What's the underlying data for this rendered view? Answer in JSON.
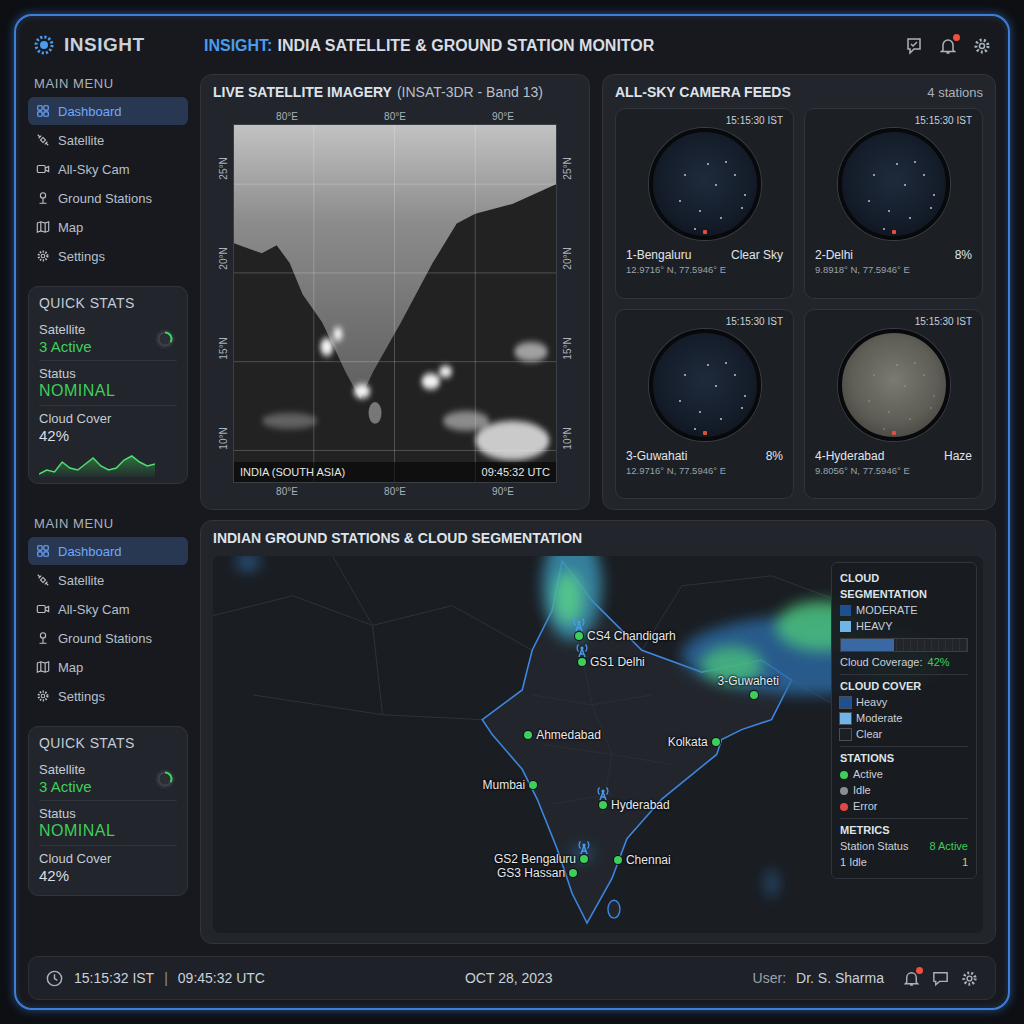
{
  "header": {
    "title_prefix": "INSIGHT:",
    "title": "INDIA SATELLITE & GROUND STATION MONITOR",
    "bell_badge": true
  },
  "sidebar": {
    "logo": "INSIGHT",
    "sections": [
      {
        "heading": "MAIN MENU",
        "items": [
          {
            "label": "Dashboard",
            "selected": true
          },
          {
            "label": "Satellite",
            "selected": false
          },
          {
            "label": "All-Sky Cam",
            "selected": false
          },
          {
            "label": "Ground Stations",
            "selected": false
          },
          {
            "label": "Map",
            "selected": false
          },
          {
            "label": "Settings",
            "selected": false
          }
        ],
        "stats": {
          "heading": "QUICK STATS",
          "satellite_label": "Satellite",
          "satellite_value": "3 Active",
          "status_label": "Status",
          "status_value": "NOMINAL",
          "cloud_label": "Cloud Cover",
          "cloud_value": "42%",
          "sparkline": [
            38,
            40,
            39,
            44,
            41,
            40,
            43,
            46,
            42,
            40,
            41,
            45,
            47,
            44,
            42,
            43
          ]
        }
      },
      {
        "heading": "MAIN MENU",
        "items": [
          {
            "label": "Dashboard",
            "selected": true
          },
          {
            "label": "Satellite",
            "selected": false
          },
          {
            "label": "All-Sky Cam",
            "selected": false
          },
          {
            "label": "Ground Stations",
            "selected": false
          },
          {
            "label": "Map",
            "selected": false
          },
          {
            "label": "Settings",
            "selected": false
          }
        ],
        "stats": {
          "heading": "QUICK STATS",
          "satellite_label": "Satellite",
          "satellite_value": "3 Active",
          "status_label": "Status",
          "status_value": "NOMINAL",
          "cloud_label": "Cloud Cover",
          "cloud_value": "42%",
          "sparkline": []
        }
      }
    ]
  },
  "satellite": {
    "title": "LIVE SATELLITE IMAGERY",
    "subtitle": "(INSAT-3DR - Band 13)",
    "top_ticks": [
      "80°E",
      "80°E",
      "90°E"
    ],
    "bottom_ticks": [
      "80°E",
      "80°E",
      "90°E"
    ],
    "left_ticks": [
      "25°N",
      "20°N",
      "15°N",
      "10°N"
    ],
    "right_ticks": [
      "25°N",
      "20°N",
      "15°N",
      "10°N"
    ],
    "region": "INDIA (SOUTH ASIA)",
    "time": "09:45:32 UTC"
  },
  "sky": {
    "title": "ALL-SKY CAMERA FEEDS",
    "count": "4 stations",
    "cameras": [
      {
        "time": "15:15:30 IST",
        "name": "1-Bengaluru",
        "status": "Clear Sky",
        "coords": "12.9716° N, 77.5946° E",
        "hazy": false
      },
      {
        "time": "15:15:30 IST",
        "name": "2-Delhi",
        "status": "8%",
        "coords": "9.8918° N, 77.5946° E",
        "hazy": false
      },
      {
        "time": "15:15:30 IST",
        "name": "3-Guwahati",
        "status": "8%",
        "coords": "12.9716° N, 77.5946° E",
        "hazy": false
      },
      {
        "time": "15:15:30 IST",
        "name": "4-Hyderabad",
        "status": "Haze",
        "coords": "9.8056° N, 77.5946° E",
        "hazy": true
      }
    ]
  },
  "map": {
    "title": "INDIAN GROUND STATIONS & CLOUD SEGMENTATION",
    "stations": [
      {
        "label": "CS4 Chandigarh",
        "kind": "ground",
        "color": "#3ecf5a"
      },
      {
        "label": "GS1 Delhi",
        "kind": "ground",
        "color": "#3ecf5a"
      },
      {
        "label": "Ahmedabad",
        "kind": "city",
        "color": "#3ecf5a"
      },
      {
        "label": "Kolkata",
        "kind": "city",
        "color": "#3ecf5a"
      },
      {
        "label": "3-Guwaheti",
        "kind": "city",
        "color": "#3ecf5a"
      },
      {
        "label": "Mumbai",
        "kind": "city",
        "color": "#3ecf5a"
      },
      {
        "label": "Hyderabad",
        "kind": "ground",
        "color": "#3ecf5a"
      },
      {
        "label": "GS2 Bengaluru",
        "kind": "ground",
        "color": "#3ecf5a"
      },
      {
        "label": "GS3 Hassan",
        "kind": "city",
        "color": "#3ecf5a"
      },
      {
        "label": "Chennai",
        "kind": "city",
        "color": "#3ecf5a"
      }
    ],
    "legend": {
      "seg_title": "CLOUD SEGMENTATION",
      "seg_items": [
        {
          "label": "MODERATE",
          "color": "#1f4f8f"
        },
        {
          "label": "HEAVY",
          "color": "#6fb6e8"
        }
      ],
      "coverage_level": 0.42,
      "coverage_label": "Cloud Coverage:",
      "coverage_value": "42%",
      "cover_title": "CLOUD COVER",
      "cover_items": [
        {
          "label": "Heavy",
          "color": "#1f4f8f"
        },
        {
          "label": "Moderate",
          "color": "#6fb6e8"
        },
        {
          "label": "Clear",
          "color": "#1c1f24"
        }
      ],
      "stations_title": "STATIONS",
      "station_items": [
        {
          "label": "Active",
          "color": "#3ecf5a"
        },
        {
          "label": "Idle",
          "color": "#8a8f96"
        },
        {
          "label": "Error",
          "color": "#e04848"
        }
      ],
      "metrics_title": "METRICS",
      "metrics": [
        {
          "label": "Station Status",
          "value": "8 Active",
          "color": "#3ecf5a"
        },
        {
          "label": "1 Idle",
          "value": "1",
          "color": "#e8c34a"
        }
      ]
    }
  },
  "footer": {
    "time_ist": "15:15:32 IST",
    "separator": "|",
    "time_utc": "09:45:32 UTC",
    "date": "OCT 28, 2023",
    "user_label": "User:",
    "user_name": "Dr. S. Sharma",
    "bell_badge": true
  }
}
